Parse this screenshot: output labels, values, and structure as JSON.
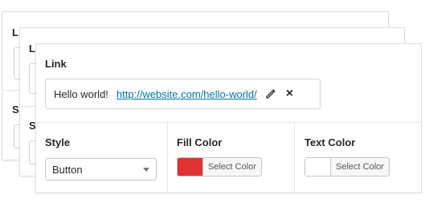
{
  "back_card_1": {
    "link_label": "L",
    "style_label": "S"
  },
  "back_card_2": {
    "link_label": "L",
    "style_label": "S"
  },
  "link_section": {
    "heading": "Link",
    "text": "Hello world!",
    "url": "http://website.com/hello-world/",
    "edit_icon": "pencil-icon",
    "remove_icon": "×"
  },
  "style_section": {
    "label": "Style",
    "selected": "Button"
  },
  "fill_color_section": {
    "label": "Fill Color",
    "button_label": "Select Color",
    "color": "#dd3333"
  },
  "text_color_section": {
    "label": "Text Color",
    "button_label": "Select Color",
    "color": "#ffffff"
  }
}
